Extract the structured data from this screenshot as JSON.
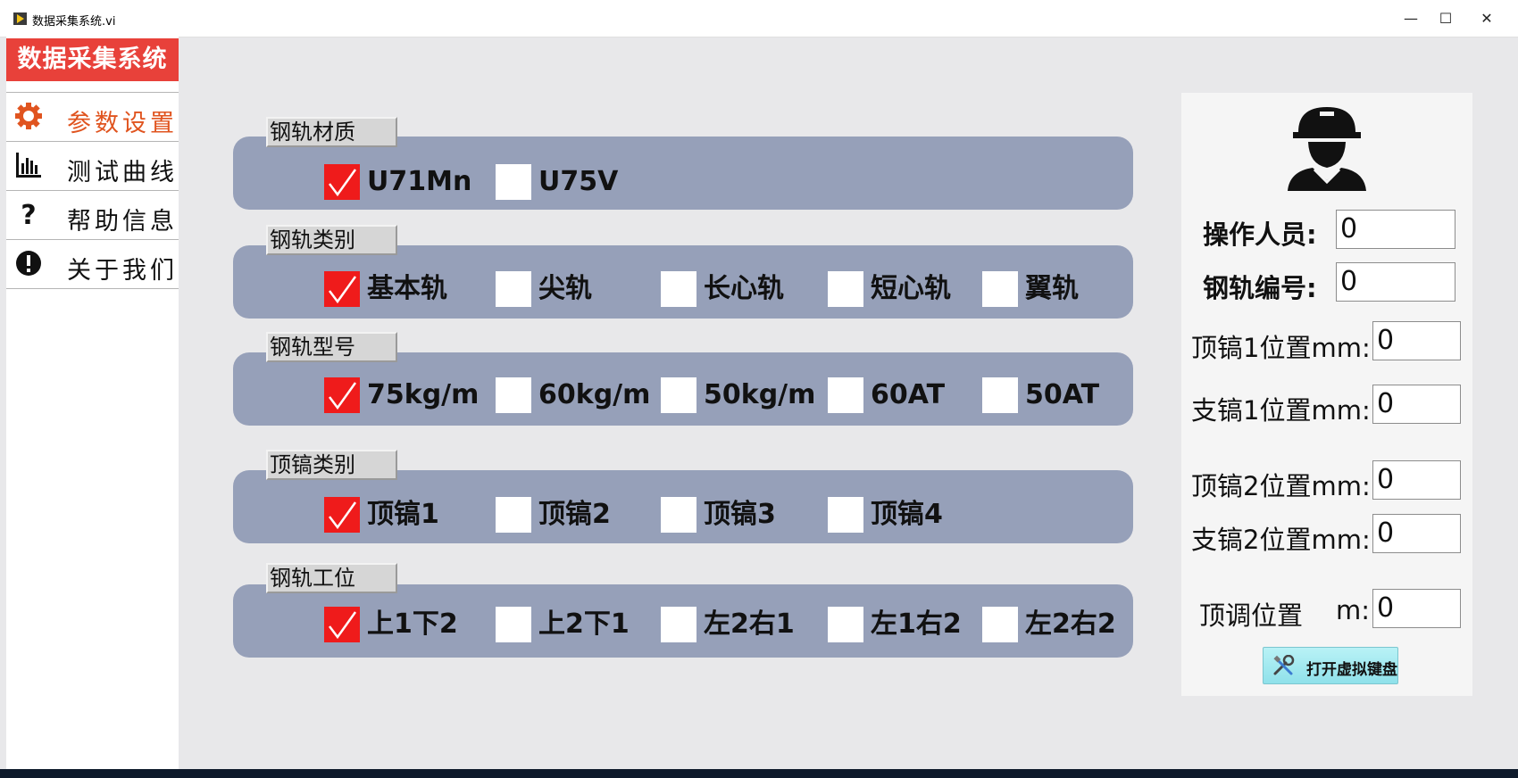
{
  "window": {
    "title": "数据采集系统.vi",
    "minimize": "—",
    "maximize": "☐",
    "close": "✕"
  },
  "sidebar": {
    "app_title": "数据采集系统",
    "items": [
      {
        "label": "参数设置",
        "icon": "gear-icon",
        "active": true
      },
      {
        "label": "测试曲线",
        "icon": "bar-chart-icon",
        "active": false
      },
      {
        "label": "帮助信息",
        "icon": "question-icon",
        "active": false
      },
      {
        "label": "关于我们",
        "icon": "exclamation-icon",
        "active": false
      }
    ]
  },
  "groups": [
    {
      "title": "钢轨材质",
      "options": [
        {
          "label": "U71Mn",
          "checked": true
        },
        {
          "label": "U75V",
          "checked": false
        }
      ]
    },
    {
      "title": "钢轨类别",
      "options": [
        {
          "label": "基本轨",
          "checked": true
        },
        {
          "label": "尖轨",
          "checked": false
        },
        {
          "label": "长心轨",
          "checked": false
        },
        {
          "label": "短心轨",
          "checked": false
        },
        {
          "label": "翼轨",
          "checked": false
        }
      ]
    },
    {
      "title": "钢轨型号",
      "options": [
        {
          "label": "75kg/m",
          "checked": true
        },
        {
          "label": "60kg/m",
          "checked": false
        },
        {
          "label": "50kg/m",
          "checked": false
        },
        {
          "label": "60AT",
          "checked": false
        },
        {
          "label": "50AT",
          "checked": false
        }
      ]
    },
    {
      "title": "顶镐类别",
      "options": [
        {
          "label": "顶镐1",
          "checked": true
        },
        {
          "label": "顶镐2",
          "checked": false
        },
        {
          "label": "顶镐3",
          "checked": false
        },
        {
          "label": "顶镐4",
          "checked": false
        }
      ]
    },
    {
      "title": "钢轨工位",
      "options": [
        {
          "label": "上1下2",
          "checked": true
        },
        {
          "label": "上2下1",
          "checked": false
        },
        {
          "label": "左2右1",
          "checked": false
        },
        {
          "label": "左1右2",
          "checked": false
        },
        {
          "label": "左2右2",
          "checked": false
        }
      ]
    }
  ],
  "panel": {
    "avatar_icon": "worker-avatar-icon",
    "operator_label": "操作人员:",
    "operator_value": "0",
    "rail_no_label": "钢轨编号:",
    "rail_no_value": "0",
    "jack1_top_label": "顶镐1位置mm:",
    "jack1_top_value": "0",
    "jack1_support_label": "支镐1位置mm:",
    "jack1_support_value": "0",
    "jack2_top_label": "顶镐2位置mm:",
    "jack2_top_value": "0",
    "jack2_support_label": "支镐2位置mm:",
    "jack2_support_value": "0",
    "adjust_label": "顶调位置",
    "adjust_unit": "m:",
    "adjust_value": "0",
    "keyboard_button": "打开虚拟键盘",
    "keyboard_icon": "tools-icon"
  },
  "colors": {
    "accent_red": "#e8413a",
    "active_menu": "#e0541f",
    "group_bar": "#96a0b9",
    "checked_box": "#ef1b1b"
  }
}
